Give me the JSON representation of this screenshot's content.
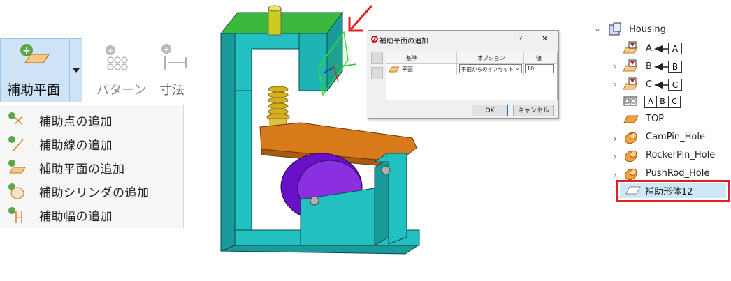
{
  "ribbon": {
    "aux_plane_label": "補助平面",
    "pattern_label": "パターン",
    "dimension_label": "寸法"
  },
  "menu": {
    "items": [
      {
        "label": "補助点の追加"
      },
      {
        "label": "補助線の追加"
      },
      {
        "label": "補助平面の追加"
      },
      {
        "label": "補助シリンダの追加"
      },
      {
        "label": "補助幅の追加"
      }
    ]
  },
  "dialog": {
    "title": "補助平面の追加",
    "help": "?",
    "close": "✕",
    "headers": {
      "base": "基準",
      "option": "オプション",
      "value": "値"
    },
    "row": {
      "base": "平面",
      "option": "平面からのオフセット",
      "value": "10"
    },
    "ok": "OK",
    "cancel": "キャンセル"
  },
  "tree": {
    "root": "Housing",
    "datum_a": "A",
    "datum_a_box": "A",
    "datum_b": "B",
    "datum_b_box": "B",
    "datum_c": "C",
    "datum_c_box": "C",
    "frame_cells": [
      "A",
      "B",
      "C"
    ],
    "top": "TOP",
    "campin": "CamPin_Hole",
    "rockerpin": "RockerPin_Hole",
    "pushrod": "PushRod_Hole",
    "new_feature": "補助形体12"
  },
  "colors": {
    "highlight_red": "#e02020",
    "ribbon_selected": "#cfe3f6",
    "model_teal": "#22b8b8",
    "model_green": "#3cb83c",
    "model_orange": "#d97a1a",
    "model_purple": "#6a10c8"
  }
}
